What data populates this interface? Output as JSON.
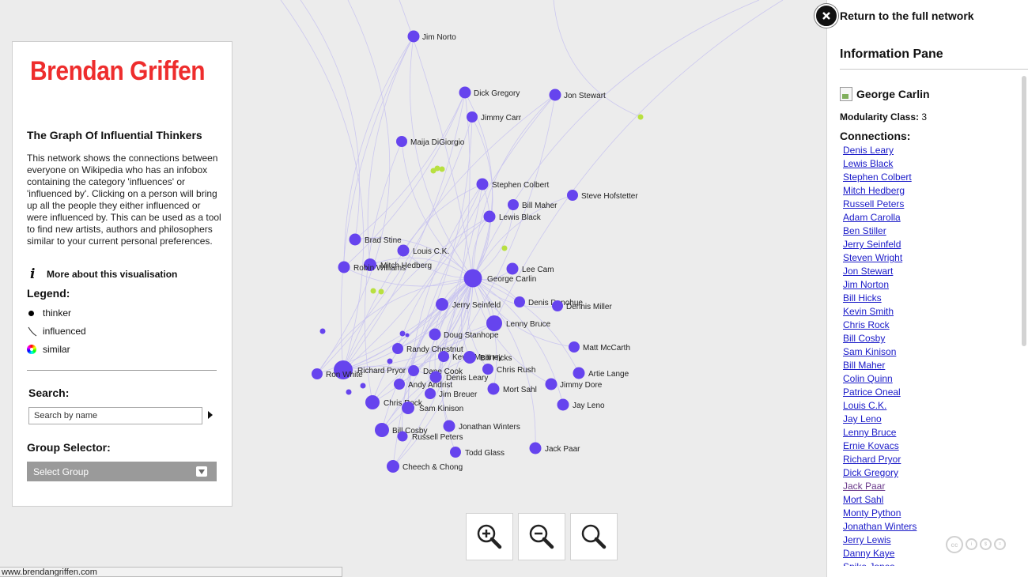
{
  "brand": {
    "name": "Brendan Griffen"
  },
  "info_panel": {
    "title": "The Graph Of Influential Thinkers",
    "description": "This network shows the connections between everyone on Wikipedia who has an infobox containing the category 'influences' or 'influenced by'. Clicking on a person will bring up all the people they either influenced or were influenced by. This can be used as a tool to find new artists, authors and philosophers similar to your current personal preferences.",
    "more_link": "More about this visualisation",
    "legend_title": "Legend:",
    "legend": [
      {
        "icon": "dot-icon",
        "label": "thinker"
      },
      {
        "icon": "edge-icon",
        "label": "influenced"
      },
      {
        "icon": "color-wheel-icon",
        "label": "similar"
      }
    ],
    "search_title": "Search:",
    "search_placeholder": "Search by name",
    "group_title": "Group Selector:",
    "group_select_value": "Select Group"
  },
  "status_bar": {
    "url": "www.brendangriffen.com"
  },
  "colors": {
    "node": "#6644ee",
    "similar": "#b8e040",
    "edge": "#c6c1f0",
    "brand": "#ee2d2d",
    "link": "#1a1ac8",
    "visited_link": "#6b3b8c"
  },
  "zoom_controls": [
    "zoom-in-icon",
    "zoom-out-icon",
    "zoom-reset-icon"
  ],
  "right_panel": {
    "return_label": "Return to the full network",
    "title": "Information Pane",
    "person": "George Carlin",
    "modularity_label": "Modularity Class:",
    "modularity_value": "3",
    "connections_title": "Connections:",
    "connections": [
      "Denis Leary",
      "Lewis Black",
      "Stephen Colbert",
      "Mitch Hedberg",
      "Russell Peters",
      "Adam Carolla",
      "Ben Stiller",
      "Jerry Seinfeld",
      "Steven Wright",
      "Jon Stewart",
      "Jim Norton",
      "Bill Hicks",
      "Kevin Smith",
      "Chris Rock",
      "Bill Cosby",
      "Sam Kinison",
      "Bill Maher",
      "Colin Quinn",
      "Patrice Oneal",
      "Louis C.K.",
      "Jay Leno",
      "Lenny Bruce",
      "Ernie Kovacs",
      "Richard Pryor",
      "Dick Gregory",
      "Jack Paar",
      "Mort Sahl",
      "Monty Python",
      "Jonathan Winters",
      "Jerry Lewis",
      "Danny Kaye",
      "Spike Jones"
    ],
    "visited": [
      "Jack Paar"
    ]
  },
  "graph": {
    "nodes": [
      {
        "label": "Jim Norto",
        "kind": "thinker"
      },
      {
        "label": "Dick Gregory",
        "kind": "thinker"
      },
      {
        "label": "Jon Stewart",
        "kind": "thinker"
      },
      {
        "label": "Jimmy Carr",
        "kind": "thinker"
      },
      {
        "label": "Maija DiGiorgio",
        "kind": "thinker"
      },
      {
        "label": "Stephen Colbert",
        "kind": "thinker"
      },
      {
        "label": "Steve Hofstetter",
        "kind": "thinker"
      },
      {
        "label": "Bill Maher",
        "kind": "thinker"
      },
      {
        "label": "Lewis Black",
        "kind": "thinker"
      },
      {
        "label": "Brad Stine",
        "kind": "thinker"
      },
      {
        "label": "Louis C.K.",
        "kind": "thinker"
      },
      {
        "label": "Mitch Hedberg",
        "kind": "thinker"
      },
      {
        "label": "Robin Williams",
        "kind": "thinker"
      },
      {
        "label": "Lee Cam",
        "kind": "thinker"
      },
      {
        "label": "George Carlin",
        "kind": "thinker"
      },
      {
        "label": "Jerry Seinfeld",
        "kind": "thinker"
      },
      {
        "label": "Denis Donohue",
        "kind": "thinker"
      },
      {
        "label": "Dennis Miller",
        "kind": "thinker"
      },
      {
        "label": "Lenny Bruce",
        "kind": "thinker"
      },
      {
        "label": "Doug Stanhope",
        "kind": "thinker"
      },
      {
        "label": "Randy Chestnut",
        "kind": "thinker"
      },
      {
        "label": "Matt McCarth",
        "kind": "thinker"
      },
      {
        "label": "Kevin Meaney",
        "kind": "thinker"
      },
      {
        "label": "Bill Hicks",
        "kind": "thinker"
      },
      {
        "label": "Richard Pryor",
        "kind": "thinker"
      },
      {
        "label": "Ron White",
        "kind": "thinker"
      },
      {
        "label": "Dane Cook",
        "kind": "thinker"
      },
      {
        "label": "Chris Rush",
        "kind": "thinker"
      },
      {
        "label": "Artie Lange",
        "kind": "thinker"
      },
      {
        "label": "Denis Leary",
        "kind": "thinker"
      },
      {
        "label": "Andy Andrist",
        "kind": "thinker"
      },
      {
        "label": "Jimmy Dore",
        "kind": "thinker"
      },
      {
        "label": "Mort Sahl",
        "kind": "thinker"
      },
      {
        "label": "Jim Breuer",
        "kind": "thinker"
      },
      {
        "label": "Chris Rock",
        "kind": "thinker"
      },
      {
        "label": "Sam Kinison",
        "kind": "thinker"
      },
      {
        "label": "Jay Leno",
        "kind": "thinker"
      },
      {
        "label": "Jonathan Winters",
        "kind": "thinker"
      },
      {
        "label": "Bill Cosby",
        "kind": "thinker"
      },
      {
        "label": "Russell Peters",
        "kind": "thinker"
      },
      {
        "label": "Jack Paar",
        "kind": "thinker"
      },
      {
        "label": "Todd Glass",
        "kind": "thinker"
      },
      {
        "label": "Cheech & Chong",
        "kind": "thinker"
      }
    ]
  }
}
